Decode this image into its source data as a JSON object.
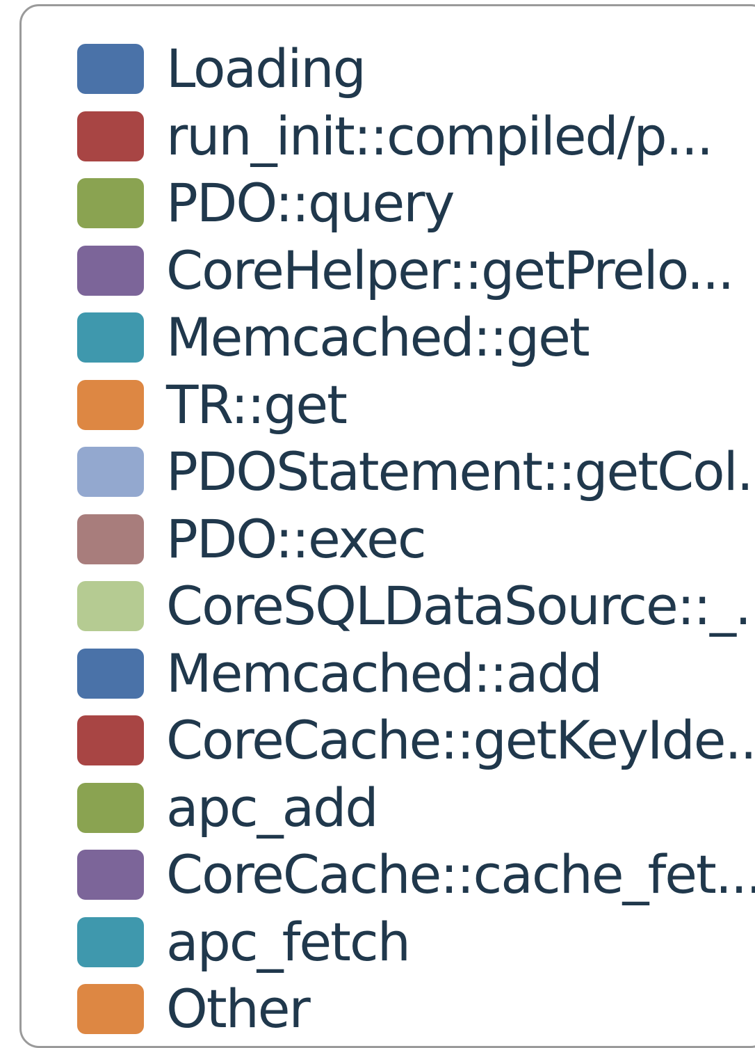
{
  "legend": {
    "items": [
      {
        "label": "Loading",
        "color": "#4a72a8"
      },
      {
        "label": "run_init::compiled/p...",
        "color": "#a84544"
      },
      {
        "label": "PDO::query",
        "color": "#8aa351"
      },
      {
        "label": "CoreHelper::getPrelo...",
        "color": "#7c6599"
      },
      {
        "label": "Memcached::get",
        "color": "#3f98ad"
      },
      {
        "label": "TR::get",
        "color": "#dd8743"
      },
      {
        "label": "PDOStatement::getCol...",
        "color": "#93a8cf"
      },
      {
        "label": "PDO::exec",
        "color": "#a87d7c"
      },
      {
        "label": "CoreSQLDataSource::_...",
        "color": "#b5cb92"
      },
      {
        "label": "Memcached::add",
        "color": "#4a72a8"
      },
      {
        "label": "CoreCache::getKeyIde...",
        "color": "#a84544"
      },
      {
        "label": "apc_add",
        "color": "#8aa351"
      },
      {
        "label": "CoreCache::cache_fet...",
        "color": "#7c6599"
      },
      {
        "label": "apc_fetch",
        "color": "#3f98ad"
      },
      {
        "label": "Other",
        "color": "#dd8743"
      }
    ]
  }
}
